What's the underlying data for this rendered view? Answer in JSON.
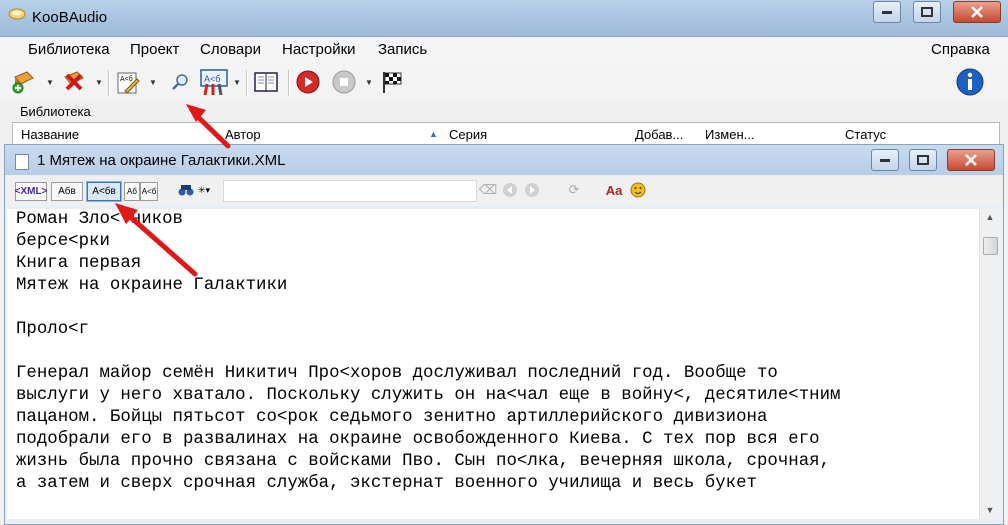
{
  "app": {
    "title": "KooBAudio"
  },
  "menu": {
    "items": [
      "Библиотека",
      "Проект",
      "Словари",
      "Настройки",
      "Запись"
    ],
    "help": "Справка"
  },
  "library": {
    "label": "Библиотека",
    "columns": {
      "name": "Название",
      "author": "Автор",
      "series": "Серия",
      "added": "Добав...",
      "changed": "Измен...",
      "status": "Статус"
    }
  },
  "document": {
    "title": "1 Мятеж на окраине Галактики.XML",
    "format_buttons": {
      "xml": "<XML>",
      "abv": "Абв",
      "aabv": "А<бв",
      "ab": "Аб",
      "a6": "А<б"
    },
    "icons": {
      "binoculars": "🔍",
      "font": "Аa"
    },
    "lines": [
      "Роман Зло<тников",
      "берсе<рки",
      "Книга первая",
      "Мятеж на окраине Галактики",
      "",
      "Проло<г",
      "",
      "Генерал майор семён Никитич Про<хоров дослуживал последний год. Вообще то",
      "выслуги у него хватало. Поскольку служить он на<чал еще в войну<, десятиле<тним",
      "пацаном. Бойцы пятьсот со<рок седьмого зенитно артиллерийского дивизиона",
      "подобрали его в развалинах на окраине освобожденного Киева. С тех пор вся его",
      "жизнь была прочно связана с войсками Пво. Сын по<лка, вечерняя школа, срочная,",
      "а затем и сверх срочная служба, экстернат военного училища и весь букет"
    ]
  },
  "colors": {
    "record": "#d42a2a",
    "info": "#1e5fc0",
    "annotation": "#e01818"
  }
}
